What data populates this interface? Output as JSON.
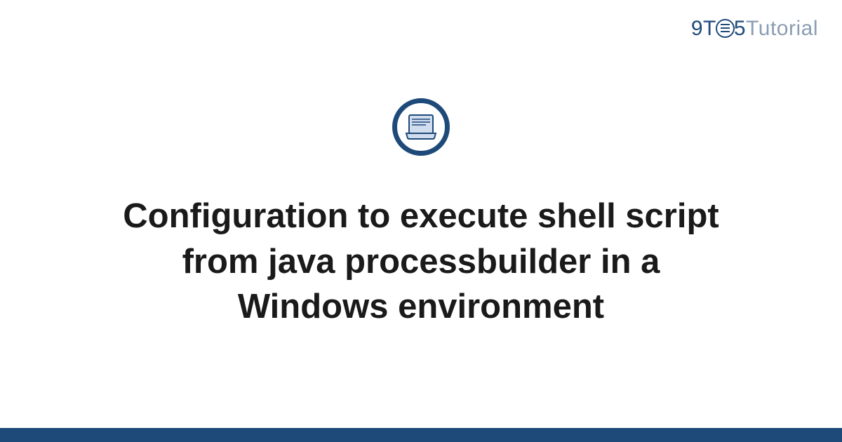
{
  "logo": {
    "part1": "9T",
    "part2": "5",
    "part3": "Tutorial"
  },
  "title": "Configuration to execute shell script from java processbuilder in a Windows environment",
  "colors": {
    "primary": "#1e4a7a",
    "secondary": "#8a9db3",
    "laptop_fill": "#d0ddef"
  }
}
